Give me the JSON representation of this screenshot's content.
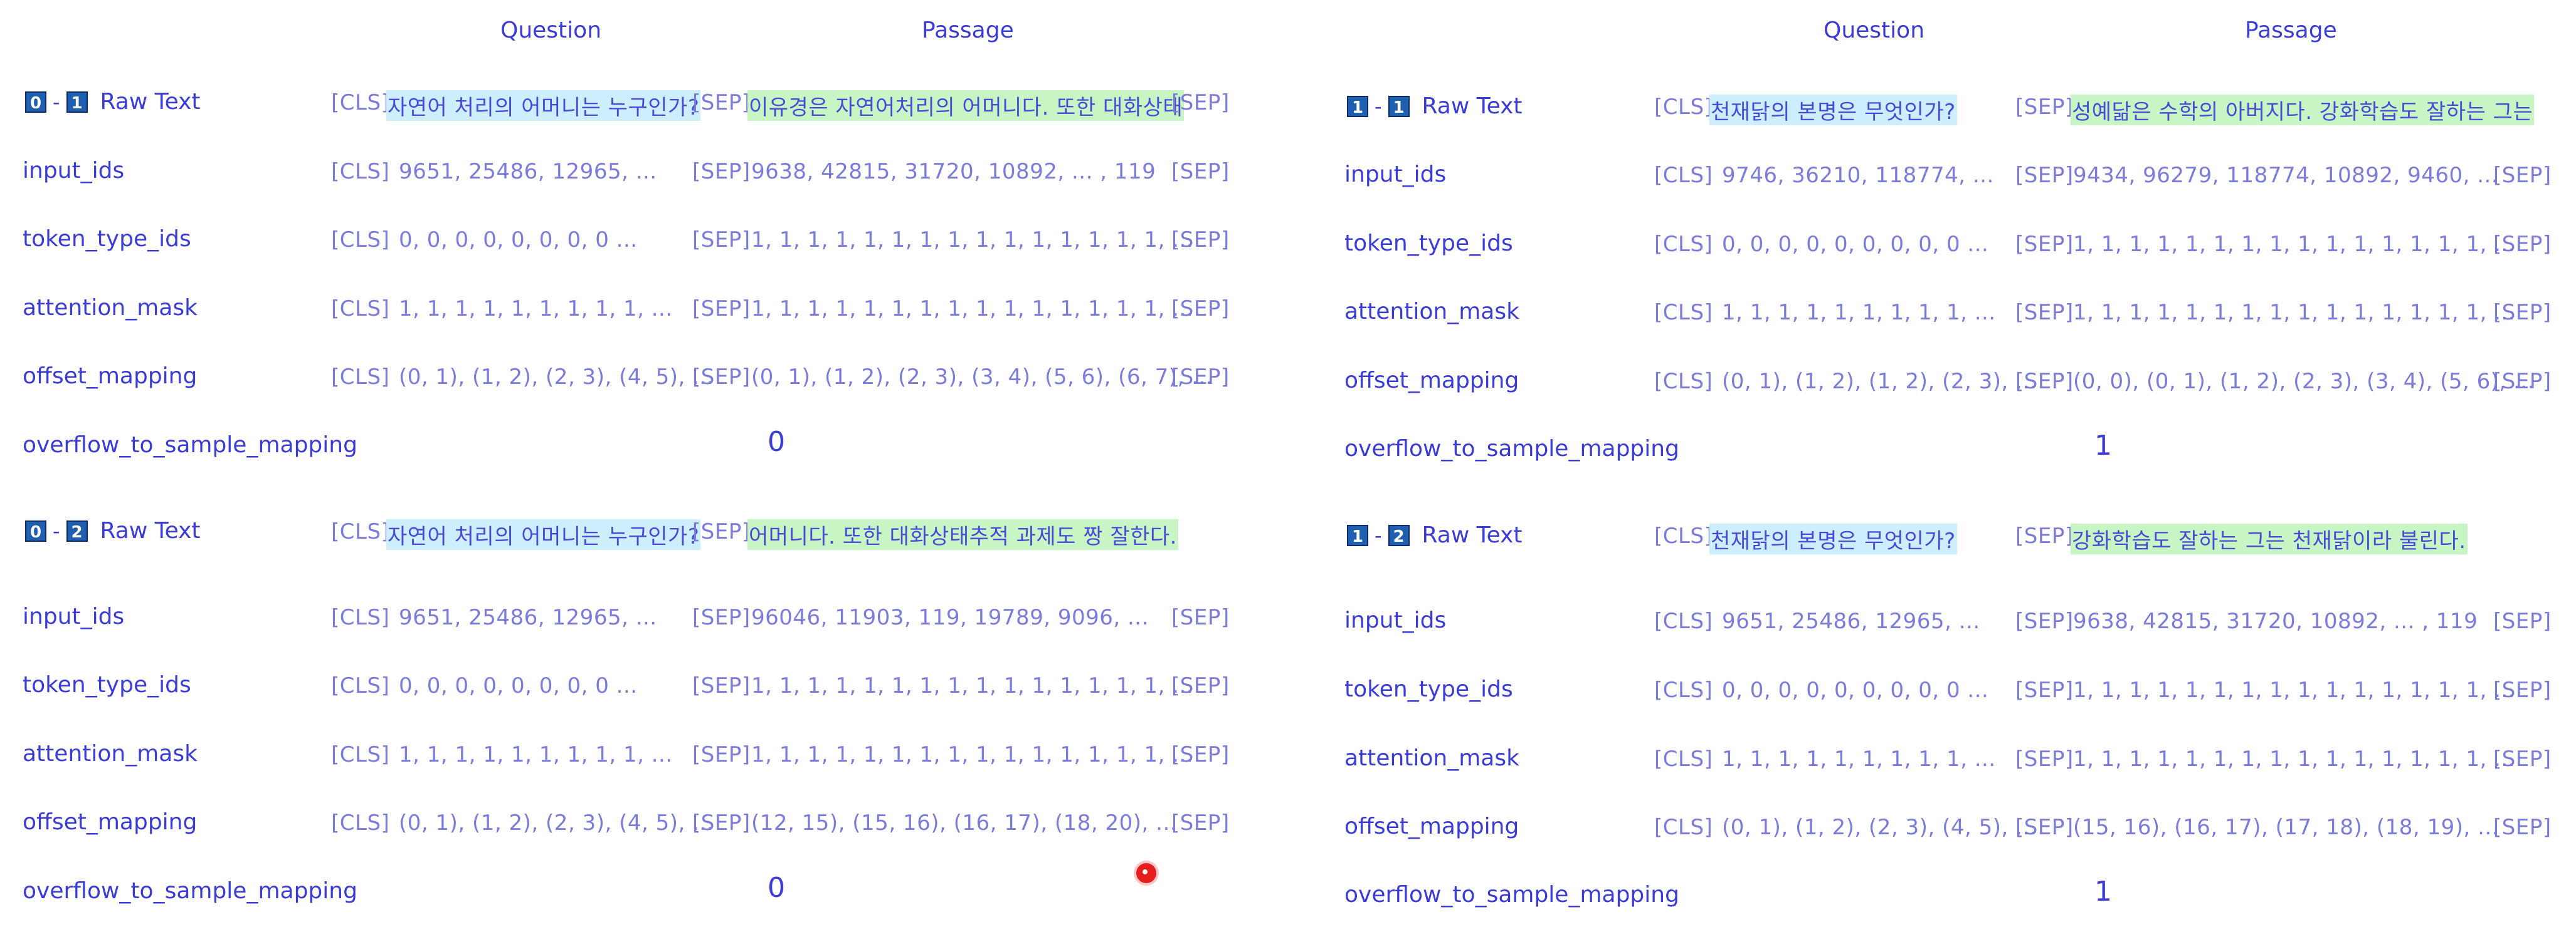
{
  "headers": {
    "question": "Question",
    "passage": "Passage"
  },
  "tokens": {
    "cls": "[CLS]",
    "sep": "[SEP]"
  },
  "labels": {
    "raw_text": "Raw Text",
    "input_ids": "input_ids",
    "token_type_ids": "token_type_ids",
    "attention_mask": "attention_mask",
    "offset_mapping": "offset_mapping",
    "overflow_to_sample_mapping": "overflow_to_sample_mapping"
  },
  "examples": [
    {
      "badge_a": "0",
      "badge_b": "1",
      "raw_question": "자연어 처리의 어머니는 누구인가?",
      "raw_passage": "이유경은 자연어처리의 어머니다. 또한 대화상태",
      "input_ids_q": "9651, 25486, 12965, ...",
      "input_ids_p": "9638, 42815, 31720, 10892,   ...  , 119",
      "token_type_ids_q": "0, 0, 0, 0, 0, 0, 0, 0 ...",
      "token_type_ids_p": "1, 1, 1, 1, 1, 1, 1, 1, 1, 1, 1, 1, 1, 1, 1, ...",
      "attention_mask_q": "1, 1, 1, 1, 1, 1, 1, 1, 1, ...",
      "attention_mask_p": "1, 1, 1, 1, 1, 1, 1, 1, 1, 1, 1, 1, 1, 1, 1, ...",
      "offset_mapping_q": "(0, 1), (1, 2), (2, 3), (4, 5), ...",
      "offset_mapping_p": "(0, 1), (1, 2), (2, 3), (3, 4), (5, 6), (6, 7), ...",
      "overflow": "0"
    },
    {
      "badge_a": "0",
      "badge_b": "2",
      "raw_question": "자연어 처리의 어머니는 누구인가?",
      "raw_passage": "어머니다. 또한 대화상태추적 과제도 짱 잘한다.",
      "input_ids_q": "9651, 25486, 12965, ...",
      "input_ids_p": "96046, 11903, 119, 19789, 9096, ...",
      "token_type_ids_q": "0, 0, 0, 0, 0, 0, 0, 0 ...",
      "token_type_ids_p": "1, 1, 1, 1, 1, 1, 1, 1, 1, 1, 1, 1, 1, 1, 1, ...",
      "attention_mask_q": "1, 1, 1, 1, 1, 1, 1, 1, 1, ...",
      "attention_mask_p": "1, 1, 1, 1, 1, 1, 1, 1, 1, 1, 1, 1, 1, 1, 1, ...",
      "offset_mapping_q": "(0, 1), (1, 2), (2, 3), (4, 5), ...",
      "offset_mapping_p": "(12, 15), (15, 16), (16, 17), (18, 20), ...",
      "overflow": "0"
    },
    {
      "badge_a": "1",
      "badge_b": "1",
      "raw_question": "천재닭의 본명은 무엇인가?",
      "raw_passage": "성예닮은 수학의 아버지다. 강화학습도 잘하는 그는",
      "input_ids_q": "9746, 36210, 118774, ...",
      "input_ids_p": "9434, 96279, 118774, 10892, 9460, ...",
      "token_type_ids_q": "0, 0, 0, 0, 0, 0, 0, 0, 0 ...",
      "token_type_ids_p": "1, 1, 1, 1, 1, 1, 1, 1, 1, 1, 1, 1, 1, 1, 1, ...",
      "attention_mask_q": "1, 1, 1, 1, 1, 1, 1, 1, 1, ...",
      "attention_mask_p": "1, 1, 1, 1, 1, 1, 1, 1, 1, 1, 1, 1, 1, 1, 1, ...",
      "offset_mapping_q": "(0, 1), (1, 2), (1, 2), (2, 3), ...",
      "offset_mapping_p": "(0, 0), (0, 1), (1, 2), (2, 3), (3, 4), (5, 6), ...",
      "overflow": "1"
    },
    {
      "badge_a": "1",
      "badge_b": "2",
      "raw_question": "천재닭의 본명은 무엇인가?",
      "raw_passage": "강화학습도 잘하는 그는 천재닭이라 불린다.",
      "input_ids_q": "9651, 25486, 12965, ...",
      "input_ids_p": "9638, 42815, 31720, 10892,   ...  , 119",
      "token_type_ids_q": "0, 0, 0, 0, 0, 0, 0, 0, 0 ...",
      "token_type_ids_p": "1, 1, 1, 1, 1, 1, 1, 1, 1, 1, 1, 1, 1, 1, 1, ...",
      "attention_mask_q": "1, 1, 1, 1, 1, 1, 1, 1, 1, ...",
      "attention_mask_p": "1, 1, 1, 1, 1, 1, 1, 1, 1, 1, 1, 1, 1, 1, 1, ...",
      "offset_mapping_q": "(0, 1), (1, 2), (2, 3), (4, 5), ...",
      "offset_mapping_p": "(15, 16), (16, 17), (17, 18), (18, 19), ...",
      "overflow": "1"
    }
  ]
}
